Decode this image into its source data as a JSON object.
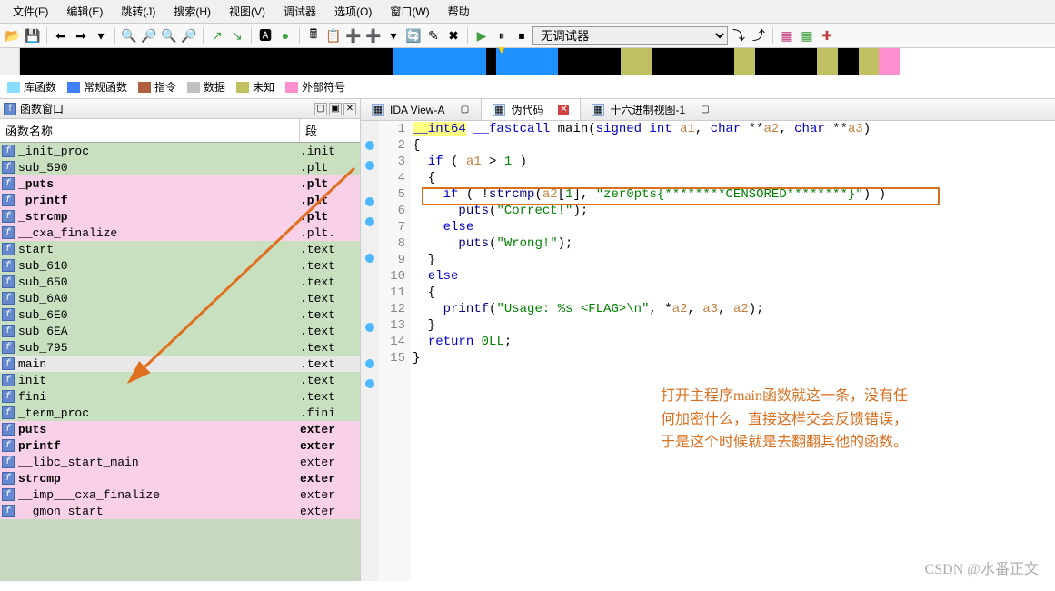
{
  "menu": [
    "文件(F)",
    "编辑(E)",
    "跳转(J)",
    "搜索(H)",
    "视图(V)",
    "调试器",
    "选项(O)",
    "窗口(W)",
    "帮助"
  ],
  "debugger_select": "无调试器",
  "legend": [
    {
      "color": "#88ddff",
      "label": "库函数"
    },
    {
      "color": "#4080ff",
      "label": "常规函数"
    },
    {
      "color": "#b06040",
      "label": "指令"
    },
    {
      "color": "#c0c0c0",
      "label": "数据"
    },
    {
      "color": "#c0c060",
      "label": "未知"
    },
    {
      "color": "#ff90d0",
      "label": "外部符号"
    }
  ],
  "panel_title": "函数窗口",
  "func_header": {
    "col1": "函数名称",
    "col2": "段"
  },
  "functions": [
    {
      "name": "_init_proc",
      "seg": ".init",
      "bg": "bg-green"
    },
    {
      "name": "sub_590",
      "seg": ".plt",
      "bg": "bg-green"
    },
    {
      "name": "_puts",
      "seg": ".plt",
      "bg": "bg-pink",
      "bold": true
    },
    {
      "name": "_printf",
      "seg": ".plt",
      "bg": "bg-pink",
      "bold": true
    },
    {
      "name": "_strcmp",
      "seg": ".plt",
      "bg": "bg-pink",
      "bold": true
    },
    {
      "name": "__cxa_finalize",
      "seg": ".plt.",
      "bg": "bg-pink"
    },
    {
      "name": "start",
      "seg": ".text",
      "bg": "bg-green"
    },
    {
      "name": "sub_610",
      "seg": ".text",
      "bg": "bg-green"
    },
    {
      "name": "sub_650",
      "seg": ".text",
      "bg": "bg-green"
    },
    {
      "name": "sub_6A0",
      "seg": ".text",
      "bg": "bg-green"
    },
    {
      "name": "sub_6E0",
      "seg": ".text",
      "bg": "bg-green"
    },
    {
      "name": "sub_6EA",
      "seg": ".text",
      "bg": "bg-green"
    },
    {
      "name": "sub_795",
      "seg": ".text",
      "bg": "bg-green"
    },
    {
      "name": "main",
      "seg": ".text",
      "bg": "bg-grey"
    },
    {
      "name": "init",
      "seg": ".text",
      "bg": "bg-green"
    },
    {
      "name": "fini",
      "seg": ".text",
      "bg": "bg-green"
    },
    {
      "name": "_term_proc",
      "seg": ".fini",
      "bg": "bg-green"
    },
    {
      "name": "puts",
      "seg": "exter",
      "bg": "bg-pink",
      "bold": true
    },
    {
      "name": "printf",
      "seg": "exter",
      "bg": "bg-pink",
      "bold": true
    },
    {
      "name": "__libc_start_main",
      "seg": "exter",
      "bg": "bg-pink"
    },
    {
      "name": "strcmp",
      "seg": "exter",
      "bg": "bg-pink",
      "bold": true
    },
    {
      "name": "__imp___cxa_finalize",
      "seg": "exter",
      "bg": "bg-pink"
    },
    {
      "name": "__gmon_start__",
      "seg": "exter",
      "bg": "bg-pink"
    }
  ],
  "tabs": [
    {
      "label": "IDA View-A",
      "active": false,
      "close": "grey"
    },
    {
      "label": "伪代码",
      "active": true,
      "close": "red"
    },
    {
      "label": "十六进制视图-1",
      "active": false,
      "close": "grey"
    }
  ],
  "code": {
    "lines": [
      {
        "n": 1,
        "bp": false,
        "html": "<span class='ty'>__int64</span> <span class='kw'>__fastcall</span> main(<span class='kw'>signed int</span> <span class='var'>a1</span>, <span class='kw'>char</span> **<span class='var'>a2</span>, <span class='kw'>char</span> **<span class='var'>a3</span>)"
      },
      {
        "n": 2,
        "bp": true,
        "html": "{"
      },
      {
        "n": 3,
        "bp": true,
        "html": "  <span class='kw'>if</span> ( <span class='var'>a1</span> &gt; <span class='num'>1</span> )"
      },
      {
        "n": 4,
        "bp": false,
        "html": "  {"
      },
      {
        "n": 5,
        "bp": true,
        "html": "    <span class='kw'>if</span> ( !<span class='fn'>strcmp</span>(<span class='var'>a2</span>[<span class='num'>1</span>], <span class='str'>\"zer0pts{********CENSORED********}\"</span>) )"
      },
      {
        "n": 6,
        "bp": true,
        "html": "      <span class='fn'>puts</span>(<span class='str'>\"Correct!\"</span>);"
      },
      {
        "n": 7,
        "bp": false,
        "html": "    <span class='kw'>else</span>"
      },
      {
        "n": 8,
        "bp": true,
        "html": "      <span class='fn'>puts</span>(<span class='str'>\"Wrong!\"</span>);"
      },
      {
        "n": 9,
        "bp": false,
        "html": "  }"
      },
      {
        "n": 10,
        "bp": false,
        "html": "  <span class='kw'>else</span>"
      },
      {
        "n": 11,
        "bp": false,
        "html": "  {"
      },
      {
        "n": 12,
        "bp": true,
        "html": "    <span class='fn'>printf</span>(<span class='str'>\"Usage: %s &lt;FLAG&gt;\\n\"</span>, *<span class='var'>a2</span>, <span class='var'>a3</span>, <span class='var'>a2</span>);"
      },
      {
        "n": 13,
        "bp": false,
        "html": "  }"
      },
      {
        "n": 14,
        "bp": true,
        "html": "  <span class='kw'>return</span> <span class='num'>0LL</span>;"
      },
      {
        "n": 15,
        "bp": true,
        "html": "}"
      }
    ]
  },
  "annotation": "打开主程序main函数就这一条，没有任\n何加密什么，直接这样交会反馈错误，\n于是这个时候就是去翻翻其他的函数。",
  "watermark": "CSDN @水番正文"
}
